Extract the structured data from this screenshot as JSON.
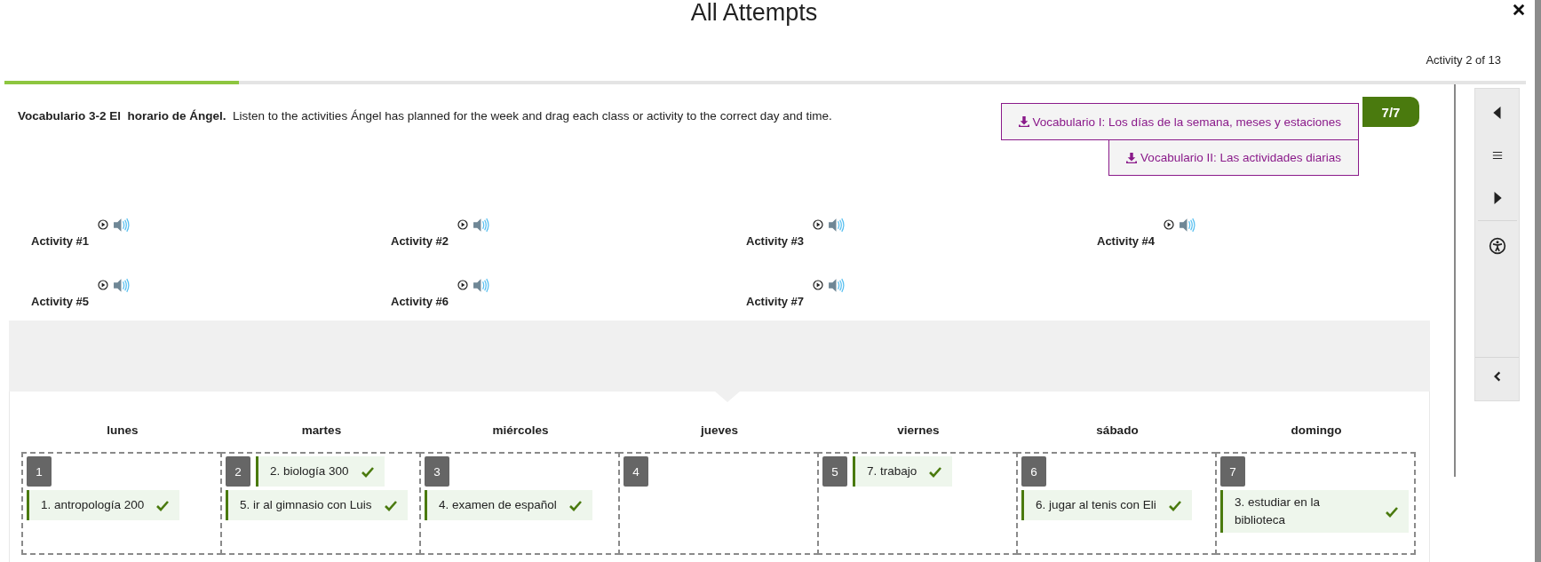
{
  "dialog": {
    "title": "All Attempts"
  },
  "progress": {
    "label": "Activity 2 of 13",
    "level": 0.154
  },
  "instructions": "**Vocabulario 3-2 El  horario de Ángel.**  Listen to the activities Ángel has planned for the week and drag each class or activity to the correct day and time.",
  "resources": [
    {
      "label": "Vocabulario I: Los días de la semana, meses y estaciones"
    },
    {
      "label": "Vocabulario II: Las actividades diarias"
    }
  ],
  "score": "7/7",
  "activities": [
    {
      "label": "Activity #1"
    },
    {
      "label": "Activity #2"
    },
    {
      "label": "Activity #3"
    },
    {
      "label": "Activity #4"
    },
    {
      "label": "Activity #5"
    },
    {
      "label": "Activity #6"
    },
    {
      "label": "Activity #7"
    }
  ],
  "days": [
    {
      "name": "lunes",
      "slot": "1",
      "answers": [
        {
          "text": "1. antropología 200",
          "correct": true,
          "kind": "below"
        }
      ]
    },
    {
      "name": "martes",
      "slot": "2",
      "answers": [
        {
          "text": "2. biología 300",
          "correct": true,
          "kind": "inline"
        },
        {
          "text": "5. ir al gimnasio con Luis",
          "correct": true,
          "kind": "below"
        }
      ]
    },
    {
      "name": "miércoles",
      "slot": "3",
      "answers": [
        {
          "text": "4. examen de español",
          "correct": true,
          "kind": "below"
        }
      ]
    },
    {
      "name": "jueves",
      "slot": "4"
    },
    {
      "name": "viernes",
      "slot": "5",
      "answers": [
        {
          "text": "7. trabajo",
          "correct": true,
          "kind": "inline"
        }
      ]
    },
    {
      "name": "sábado",
      "slot": "6",
      "answers": [
        {
          "text": "6. jugar al tenis con Eli",
          "correct": true,
          "kind": "below"
        }
      ]
    },
    {
      "name": "domingo",
      "slot": "7",
      "answers": [
        {
          "text": "3. estudiar en la biblioteca",
          "correct": true,
          "kind": "below"
        }
      ]
    }
  ]
}
